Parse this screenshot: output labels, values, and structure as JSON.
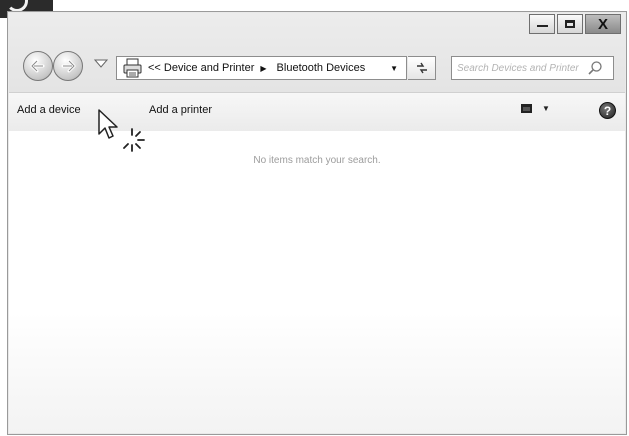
{
  "window": {
    "controls": {
      "minimize_icon": "minimize-icon",
      "maximize_icon": "maximize-icon",
      "close_label": "X"
    }
  },
  "navigation": {
    "address": {
      "crumbs": [
        "<< Device and Printer",
        "Bluetooth Devices"
      ],
      "icon": "devices-printer-icon"
    },
    "search": {
      "placeholder": "Search Devices and Printer"
    }
  },
  "toolbar": {
    "add_device_label": "Add a device",
    "add_printer_label": "Add a printer",
    "help_label": "?"
  },
  "content": {
    "empty_message": "No items match your search."
  }
}
